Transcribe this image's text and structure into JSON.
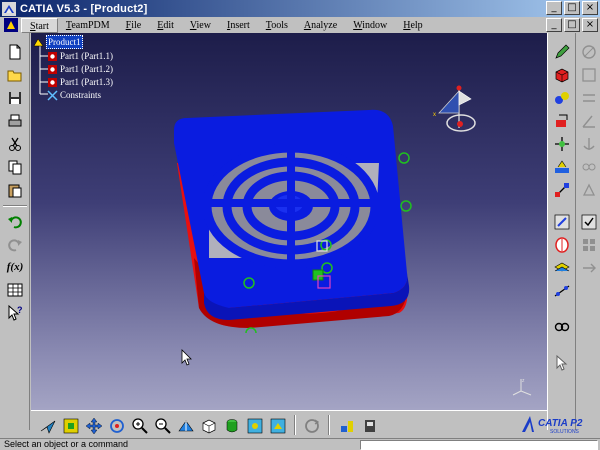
{
  "window": {
    "title": "CATIA V5.3 - [Product2]",
    "minimize_label": "_",
    "maximize_label": "□",
    "close_label": "×"
  },
  "menu": {
    "items": [
      {
        "label": "Start",
        "underline": "S",
        "rest": "tart",
        "active": true
      },
      {
        "label": "TeamPDM",
        "underline": "T",
        "rest": "eamPDM"
      },
      {
        "label": "File",
        "underline": "F",
        "rest": "ile"
      },
      {
        "label": "Edit",
        "underline": "E",
        "rest": "dit"
      },
      {
        "label": "View",
        "underline": "V",
        "rest": "iew"
      },
      {
        "label": "Insert",
        "underline": "I",
        "rest": "nsert"
      },
      {
        "label": "Tools",
        "underline": "T",
        "rest": "ools"
      },
      {
        "label": "Analyze",
        "underline": "A",
        "rest": "nalyze"
      },
      {
        "label": "Window",
        "underline": "W",
        "rest": "indow"
      },
      {
        "label": "Help",
        "underline": "H",
        "rest": "elp"
      }
    ]
  },
  "tree": {
    "root": "Product1",
    "items": [
      "Part1 (Part1.1)",
      "Part1 (Part1.2)",
      "Part1 (Part1.3)",
      "Constraints"
    ]
  },
  "left_toolbar": {
    "formula_label": "f(x)"
  },
  "status": {
    "message": "Select an object or a command",
    "command_input": ""
  },
  "logo": {
    "text": "CATIA P2",
    "sub": "SOLUTIONS"
  },
  "colors": {
    "title_bar": "#0a246a",
    "viewport_top": "#1d1d4a",
    "viewport_bottom": "#a4a4c4",
    "part_blue": "#0a24d8",
    "part_red": "#e01010",
    "constraint_green": "#20c020"
  }
}
